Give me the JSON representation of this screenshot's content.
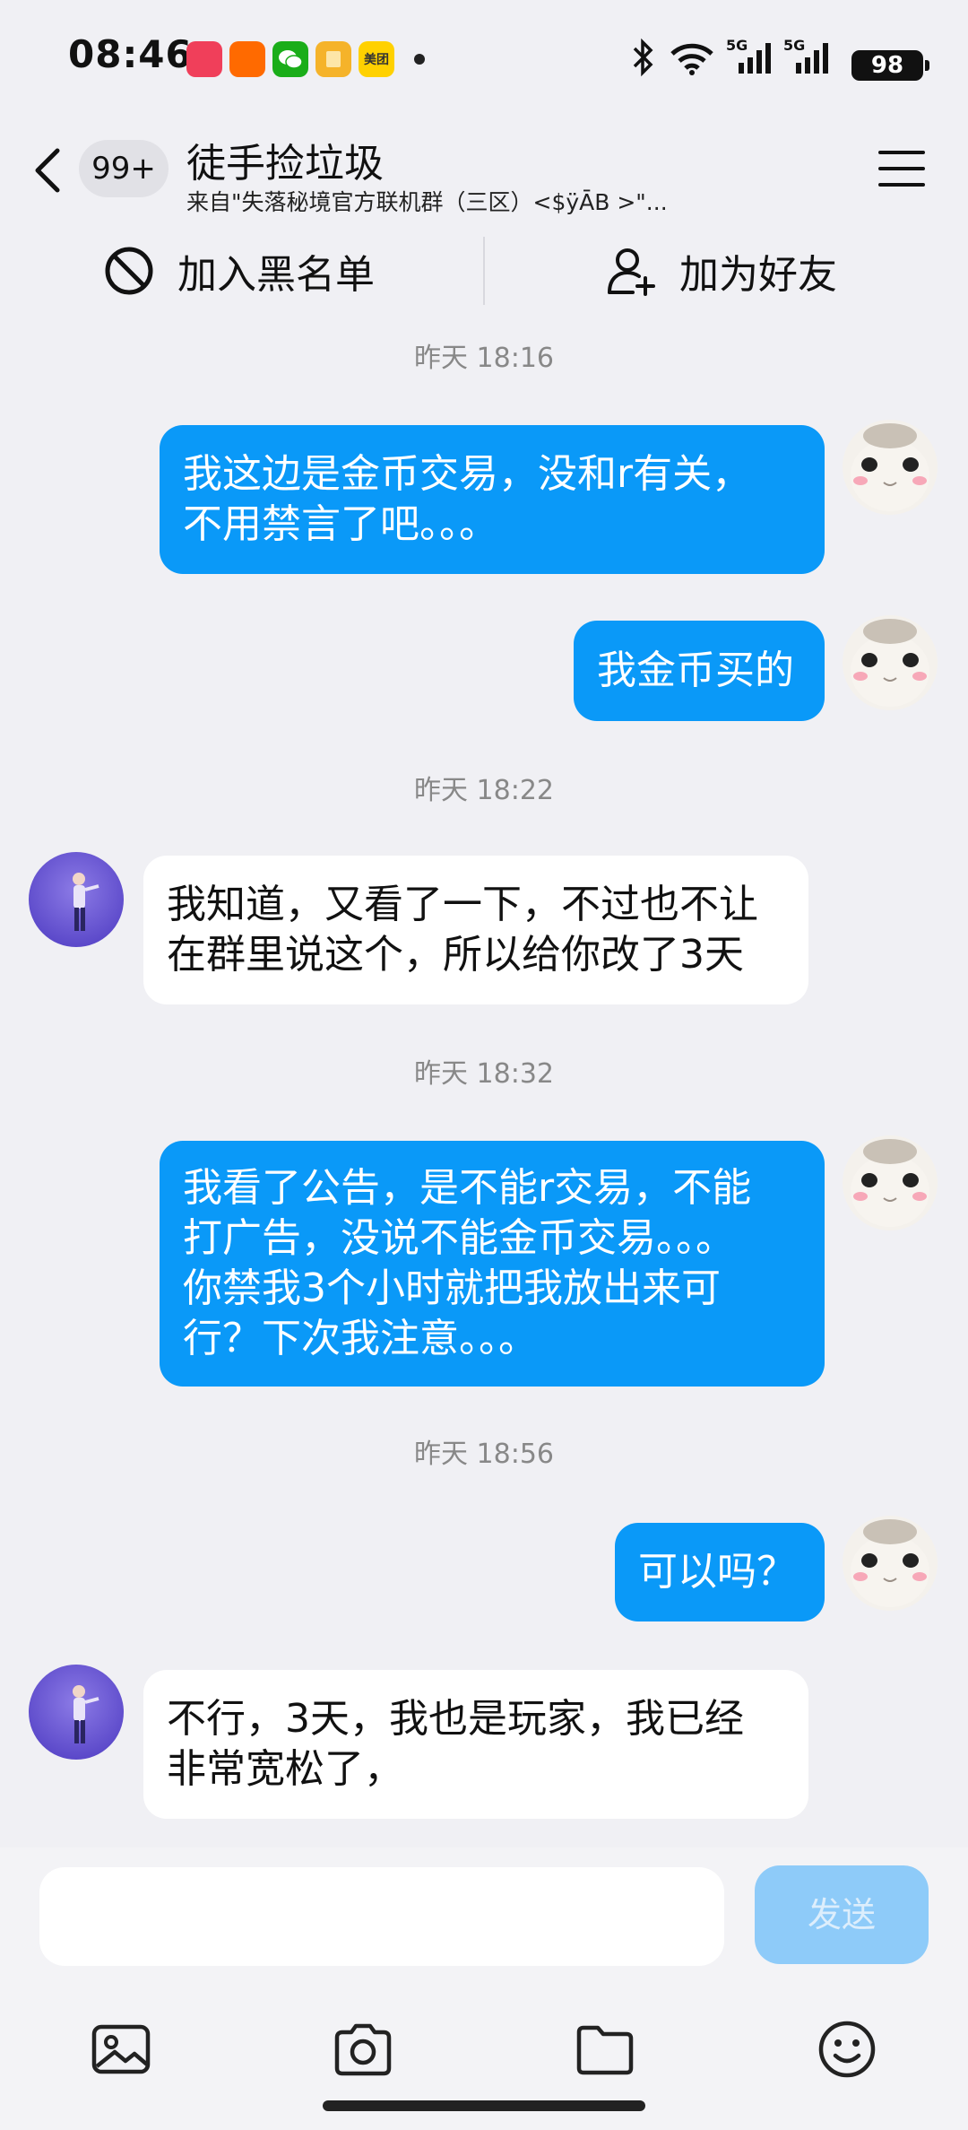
{
  "status_bar": {
    "time": "08:46",
    "app_icons": [
      {
        "name": "pinduoduo-icon",
        "color": "#f03f5a"
      },
      {
        "name": "taobao-icon",
        "color": "#ff6a00"
      },
      {
        "name": "wechat-icon",
        "color": "#1aad19"
      },
      {
        "name": "reader-icon",
        "color": "#f5b32a"
      },
      {
        "name": "meituan-icon",
        "color": "#ffd100",
        "label": "美团"
      }
    ],
    "network": "5G",
    "battery": "98"
  },
  "header": {
    "unread_badge": "99+",
    "contact_name": "徒手捡垃圾",
    "source": "来自\"失落秘境官方联机群（三区）<$ÿĀB >\"..."
  },
  "actions": {
    "block": "加入黑名单",
    "add_friend": "加为好友"
  },
  "messages": [
    {
      "type": "time",
      "text": "昨天 18:16"
    },
    {
      "type": "self",
      "text": "我这边是金币交易，没和r有关，\n不用禁言了吧。。。"
    },
    {
      "type": "self",
      "text": "我金币买的"
    },
    {
      "type": "time",
      "text": "昨天 18:22"
    },
    {
      "type": "other",
      "text": "我知道，又看了一下，不过也不让\n在群里说这个，所以给你改了3天"
    },
    {
      "type": "time",
      "text": "昨天 18:32"
    },
    {
      "type": "self",
      "text": "我看了公告，是不能r交易，不能\n打广告，没说不能金币交易。。。\n你禁我3个小时就把我放出来可\n行？下次我注意。。。"
    },
    {
      "type": "time",
      "text": "昨天 18:56"
    },
    {
      "type": "self",
      "text": "可以吗？"
    },
    {
      "type": "other",
      "text": "不行，3天，我也是玩家，我已经\n非常宽松了，"
    }
  ],
  "input": {
    "placeholder": "",
    "send_label": "发送"
  },
  "colors": {
    "self_bubble": "#0a99f8",
    "other_bubble": "#ffffff",
    "background": "#f0f0f4",
    "send_disabled": "#8ecbf9"
  }
}
